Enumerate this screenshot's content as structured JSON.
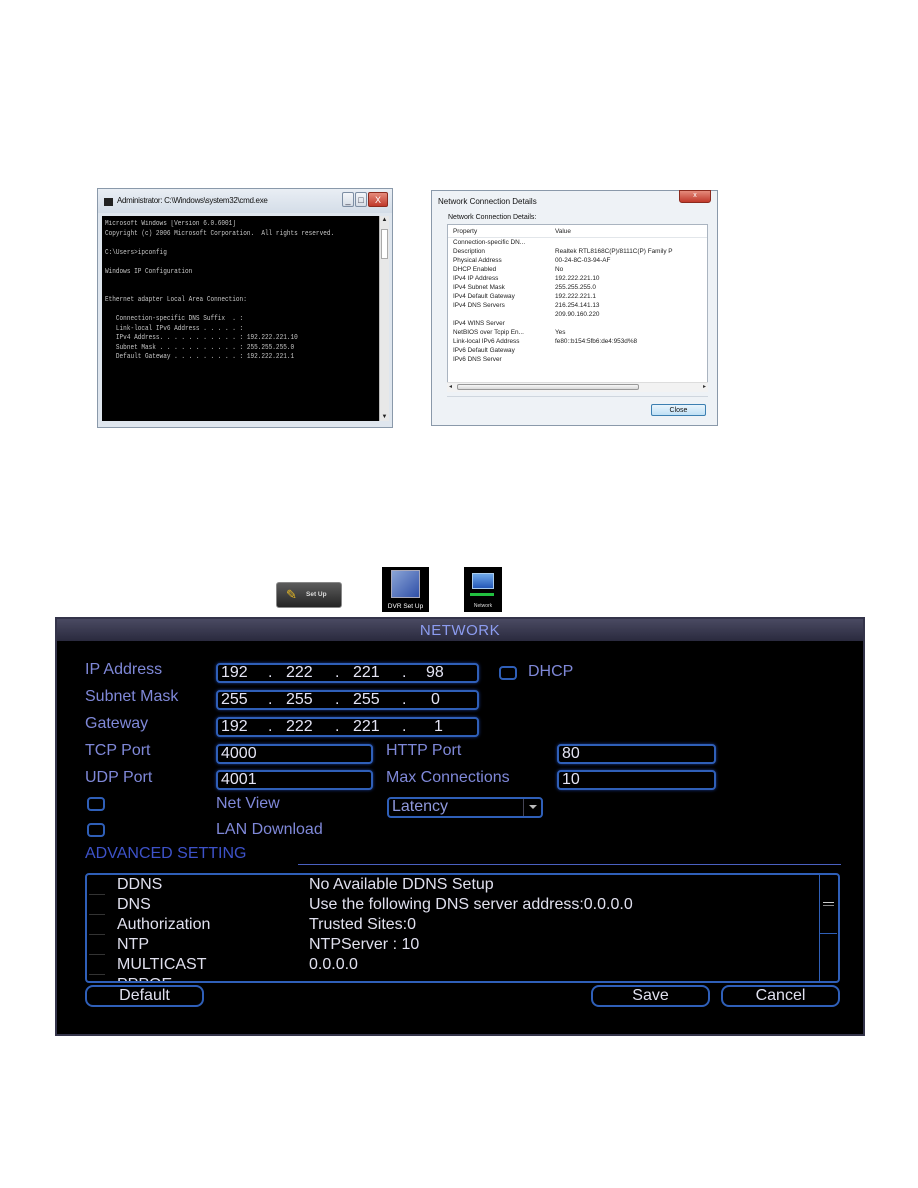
{
  "cmd_window": {
    "title": "Administrator: C:\\Windows\\system32\\cmd.exe",
    "controls": {
      "minimize": "_",
      "maximize": "□",
      "close": "X"
    },
    "lines": [
      "Microsoft Windows [Version 6.0.6001]",
      "Copyright (c) 2006 Microsoft Corporation.  All rights reserved.",
      "",
      "C:\\Users>ipconfig",
      "",
      "Windows IP Configuration",
      "",
      "",
      "Ethernet adapter Local Area Connection:",
      "",
      "   Connection-specific DNS Suffix  . :",
      "   Link-local IPv6 Address . . . . . :",
      "   IPv4 Address. . . . . . . . . . . : 192.222.221.10",
      "   Subnet Mask . . . . . . . . . . . : 255.255.255.0",
      "   Default Gateway . . . . . . . . . : 192.222.221.1"
    ]
  },
  "details_dialog": {
    "title": "Network Connection Details",
    "close_x": "x",
    "subtitle": "Network Connection Details:",
    "columns": [
      "Property",
      "Value"
    ],
    "rows": [
      {
        "property": "Connection-specific DN...",
        "value": ""
      },
      {
        "property": "Description",
        "value": "Realtek RTL8168C(P)/8111C(P) Family P"
      },
      {
        "property": "Physical Address",
        "value": "00-24-8C-03-94-AF"
      },
      {
        "property": "DHCP Enabled",
        "value": "No"
      },
      {
        "property": "IPv4 IP Address",
        "value": "192.222.221.10"
      },
      {
        "property": "IPv4 Subnet Mask",
        "value": "255.255.255.0"
      },
      {
        "property": "IPv4 Default Gateway",
        "value": "192.222.221.1"
      },
      {
        "property": "IPv4 DNS Servers",
        "value": "216.254.141.13"
      },
      {
        "property": "",
        "value": "209.90.160.220"
      },
      {
        "property": "IPv4 WINS Server",
        "value": ""
      },
      {
        "property": "NetBIOS over Tcpip En...",
        "value": "Yes"
      },
      {
        "property": "Link-local IPv6 Address",
        "value": "fe80::b154:5fb6:de4:953d%8"
      },
      {
        "property": "IPv6 Default Gateway",
        "value": ""
      },
      {
        "property": "IPv6 DNS Server",
        "value": ""
      }
    ],
    "scroll_grip": "III",
    "close_button": "Close"
  },
  "menu_path": {
    "setup_label": "Set Up",
    "dvr_setup_label": "DVR Set Up",
    "network_label": "Network"
  },
  "network_panel": {
    "title": "NETWORK",
    "ip_address": {
      "label": "IP Address",
      "octets": [
        "192",
        "222",
        "221",
        "98"
      ]
    },
    "dhcp": {
      "label": "DHCP",
      "checked": false
    },
    "subnet_mask": {
      "label": "Subnet Mask",
      "octets": [
        "255",
        "255",
        "255",
        "0"
      ]
    },
    "gateway": {
      "label": "Gateway",
      "octets": [
        "192",
        "222",
        "221",
        "1"
      ]
    },
    "tcp_port": {
      "label": "TCP Port",
      "value": "4000"
    },
    "http_port": {
      "label": "HTTP Port",
      "value": "80"
    },
    "udp_port": {
      "label": "UDP Port",
      "value": "4001"
    },
    "max_connections": {
      "label": "Max Connections",
      "value": "10"
    },
    "net_view": {
      "label": "Net View",
      "checked": false,
      "mode": "Latency"
    },
    "lan_download": {
      "label": "LAN Download",
      "checked": false
    },
    "advanced_heading": "ADVANCED SETTING",
    "advanced_rows": [
      {
        "name": "DDNS",
        "value": "No Available DDNS Setup"
      },
      {
        "name": "DNS",
        "value": "Use the following DNS server address:0.0.0.0"
      },
      {
        "name": "Authorization",
        "value": "Trusted Sites:0"
      },
      {
        "name": "NTP",
        "value": "NTPServer : 10"
      },
      {
        "name": "MULTICAST",
        "value": "0.0.0.0"
      },
      {
        "name": "PPPOE",
        "value": ""
      }
    ],
    "buttons": {
      "default": "Default",
      "save": "Save",
      "cancel": "Cancel"
    },
    "accent_color": "#2f5fb8",
    "label_color": "#7f88d8"
  }
}
